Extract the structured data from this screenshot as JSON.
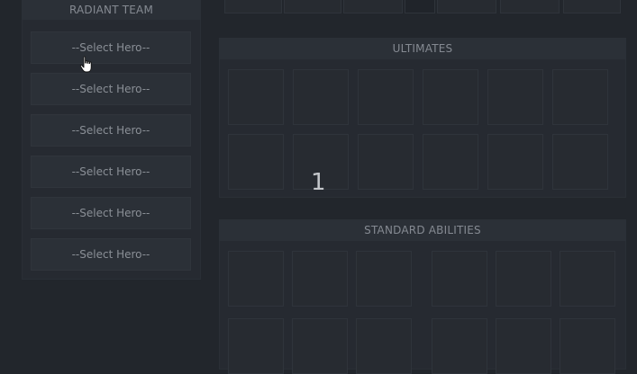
{
  "radiant": {
    "title": "RADIANT TEAM",
    "slots": [
      "--Select Hero--",
      "--Select Hero--",
      "--Select Hero--",
      "--Select Hero--",
      "--Select Hero--",
      "--Select Hero--"
    ]
  },
  "ultimates": {
    "title": "ULTIMATES"
  },
  "standard": {
    "title": "STANDARD ABILITIES"
  },
  "overlay": {
    "counter": "1"
  }
}
